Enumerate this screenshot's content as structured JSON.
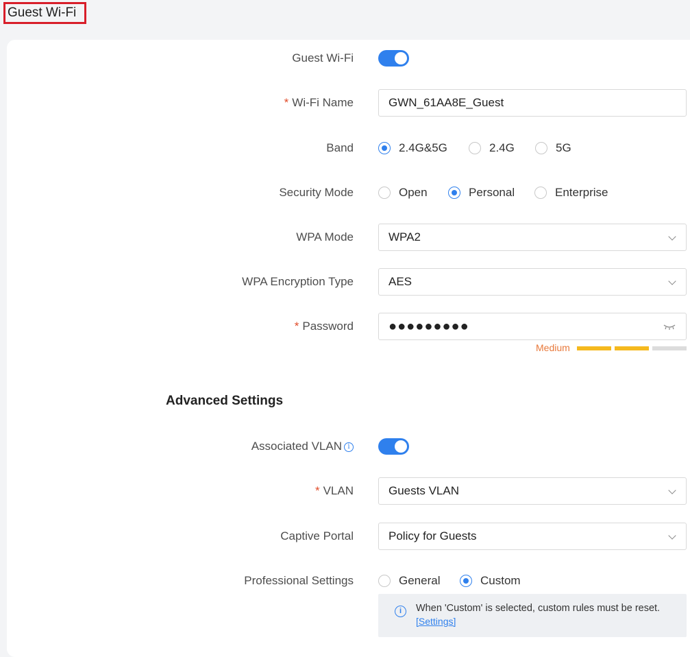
{
  "page": {
    "title": "Guest Wi-Fi"
  },
  "form": {
    "guest_wifi": {
      "label": "Guest Wi-Fi",
      "enabled": true
    },
    "wifi_name": {
      "label": "Wi-Fi Name",
      "required_mark": "*",
      "value": "GWN_61AA8E_Guest"
    },
    "band": {
      "label": "Band",
      "options": [
        "2.4G&5G",
        "2.4G",
        "5G"
      ],
      "selected": "2.4G&5G"
    },
    "security_mode": {
      "label": "Security Mode",
      "options": [
        "Open",
        "Personal",
        "Enterprise"
      ],
      "selected": "Personal"
    },
    "wpa_mode": {
      "label": "WPA Mode",
      "value": "WPA2"
    },
    "wpa_encryption": {
      "label": "WPA Encryption Type",
      "value": "AES"
    },
    "password": {
      "label": "Password",
      "required_mark": "*",
      "masked_value": "●●●●●●●●●",
      "strength_label": "Medium",
      "strength_level": 2,
      "strength_max": 3,
      "strength_color": "#f5b91e",
      "strength_empty_color": "#dcdcdc"
    }
  },
  "advanced": {
    "title": "Advanced Settings",
    "associated_vlan": {
      "label": "Associated VLAN",
      "enabled": true,
      "info_icon": "info-icon"
    },
    "vlan": {
      "label": "VLAN",
      "required_mark": "*",
      "value": "Guests VLAN"
    },
    "captive_portal": {
      "label": "Captive Portal",
      "value": "Policy for Guests"
    },
    "professional_settings": {
      "label": "Professional Settings",
      "options": [
        "General",
        "Custom"
      ],
      "selected": "Custom"
    },
    "notice": {
      "text": "When 'Custom' is selected, custom rules must be reset.",
      "link": "[Settings]"
    }
  },
  "colors": {
    "accent": "#2f80ed",
    "required": "#e14c2a",
    "highlight_border": "#d81e2a"
  }
}
